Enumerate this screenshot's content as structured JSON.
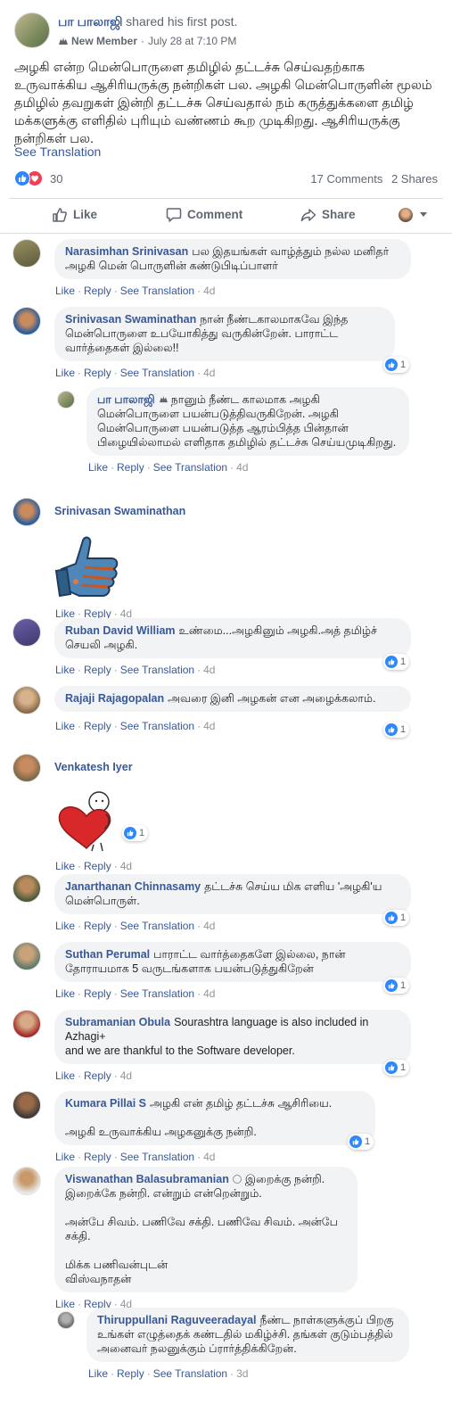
{
  "post": {
    "author": "பா பாலாஜி",
    "action": "shared his first post.",
    "badge": "New Member",
    "date": "July 28 at 7:10 PM",
    "text": "அழகி என்ற மென்பொருளை தமிழில் தட்டச்சு செய்வதற்காக உருவாக்கிய ஆசிரியருக்கு நன்றிகள் பல. அழகி மென்பொருளின் மூலம் தமிழில் தவறுகள் இன்றி தட்டச்சு செய்வதால் நம் கருத்துக்களை தமிழ் மக்களுக்கு எளிதில் புரியும் வண்ணம் கூற முடிகிறது. ஆசிரியருக்கு நன்றிகள் பல.",
    "see_translation": "See Translation",
    "reaction_count": "30",
    "comments_count": "17 Comments",
    "shares_count": "2 Shares",
    "actions": {
      "like": "Like",
      "comment": "Comment",
      "share": "Share"
    },
    "colors": {
      "link": "#385898",
      "like_blue": "#2d88ff",
      "love_red": "#f33e58"
    }
  },
  "labels": {
    "like": "Like",
    "reply": "Reply",
    "see_translation": "See Translation"
  },
  "comments": [
    {
      "author": "Narasimhan Srinivasan",
      "text": "பல இதயங்கள் வாழ்த்தும் நல்ல மனிதர் அழகி மென் பொருளின் கண்டுபிடிப்பாளர்",
      "time": "4d"
    },
    {
      "author": "Srinivasan Swaminathan",
      "text": "நான் நீண்டகாலமாகவே இந்த மென்பொருளை உபயோகித்து வருகின்றேன். பாராட்ட வார்த்தைகள் இல்லை!!",
      "time": "4d",
      "likes": "1"
    },
    {
      "author": "பா பாலாஜி",
      "text": "நானும் நீண்ட காலமாக அழகி மென்பொருளை பயன்படுத்திவருகிறேன். அழகி மென்பொருளை பயன்படுத்த ஆரம்பித்த பின்தான் பிழையில்லாமல் எளிதாக தமிழில் தட்டச்சு செய்யமுடிகிறது.",
      "time": "4d"
    },
    {
      "author": "Srinivasan Swaminathan",
      "time": "4d"
    },
    {
      "author": "Ruban David William",
      "text": "உண்மை...அழகினும் அழகி.அத் தமிழ்ச் செயலி அழகி.",
      "time": "4d",
      "likes": "1"
    },
    {
      "author": "Rajaji Rajagopalan",
      "text": "அவரை இனி அழகன் என அழைக்கலாம்.",
      "time": "4d",
      "likes": "1"
    },
    {
      "author": "Venkatesh Iyer",
      "time": "4d",
      "likes": "1"
    },
    {
      "author": "Janarthanan Chinnasamy",
      "text": "தட்டச்சு செய்ய மிக எளிய 'அழகி'ய மென்பொருள்.",
      "time": "4d",
      "likes": "1"
    },
    {
      "author": "Suthan Perumal",
      "text": "பாராட்ட வார்த்தைகளே இல்லை, நான் தோராயமாக 5 வருடங்களாக பயன்படுத்துகிறேன்",
      "time": "4d",
      "likes": "1"
    },
    {
      "author": "Subramanian Obula",
      "text": "Sourashtra language is also included in Azhagi+\nand we are thankful to the Software developer.",
      "time": "4d",
      "likes": "1"
    },
    {
      "author": "Kumara Pillai S",
      "text": "அழகி என் தமிழ் தட்டச்சு ஆசிரியை.\n\nஅழகி உருவாக்கிய அழகனுக்கு நன்றி.",
      "time": "4d",
      "likes": "1"
    },
    {
      "author": "Viswanathan Balasubramanian",
      "text": "இறைக்கு நன்றி. இறைக்கே நன்றி. என்றும் என்றென்றும்.\n\nஅன்பே சிவம். பணிவே சக்தி. பணிவே சிவம். அன்பே சக்தி.\n\nமிக்க பணிவன்புடன்\nவிஸ்வநாதன்",
      "time": "4d"
    },
    {
      "author": "Thiruppullani Raguveeradayal",
      "text": "நீண்ட நாள்களுக்குப் பிறகு உங்கள் எழுத்தைக் கண்டதில் மகிழ்ச்சி. தங்கள் குடும்பத்தில் அனைவர் நலனுக்கும் ப்ரார்த்திக்கிறேன்.",
      "time": "3d"
    }
  ]
}
